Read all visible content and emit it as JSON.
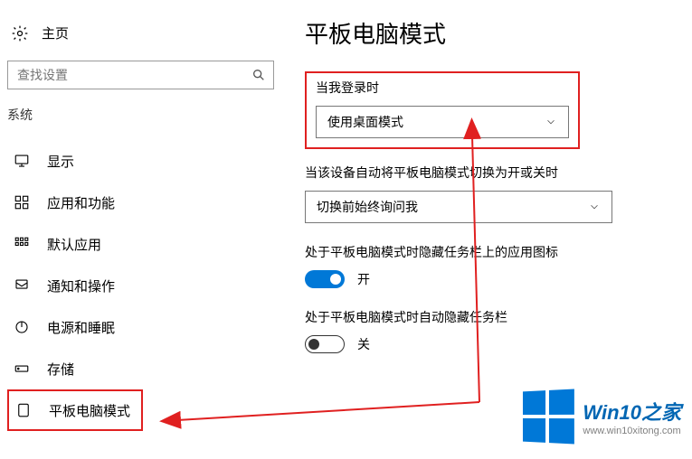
{
  "sidebar": {
    "home_label": "主页",
    "search_placeholder": "查找设置",
    "section_title": "系统",
    "items": [
      {
        "label": "显示"
      },
      {
        "label": "应用和功能"
      },
      {
        "label": "默认应用"
      },
      {
        "label": "通知和操作"
      },
      {
        "label": "电源和睡眠"
      },
      {
        "label": "存储"
      },
      {
        "label": "平板电脑模式"
      }
    ]
  },
  "main": {
    "title": "平板电脑模式",
    "signin_label": "当我登录时",
    "signin_value": "使用桌面模式",
    "autoswitch_label": "当该设备自动将平板电脑模式切换为开或关时",
    "autoswitch_value": "切换前始终询问我",
    "hide_icons_label": "处于平板电脑模式时隐藏任务栏上的应用图标",
    "hide_icons_state": "开",
    "auto_hide_label": "处于平板电脑模式时自动隐藏任务栏",
    "auto_hide_state": "关"
  },
  "watermark": {
    "title": "Win10之家",
    "url": "www.win10xitong.com"
  }
}
